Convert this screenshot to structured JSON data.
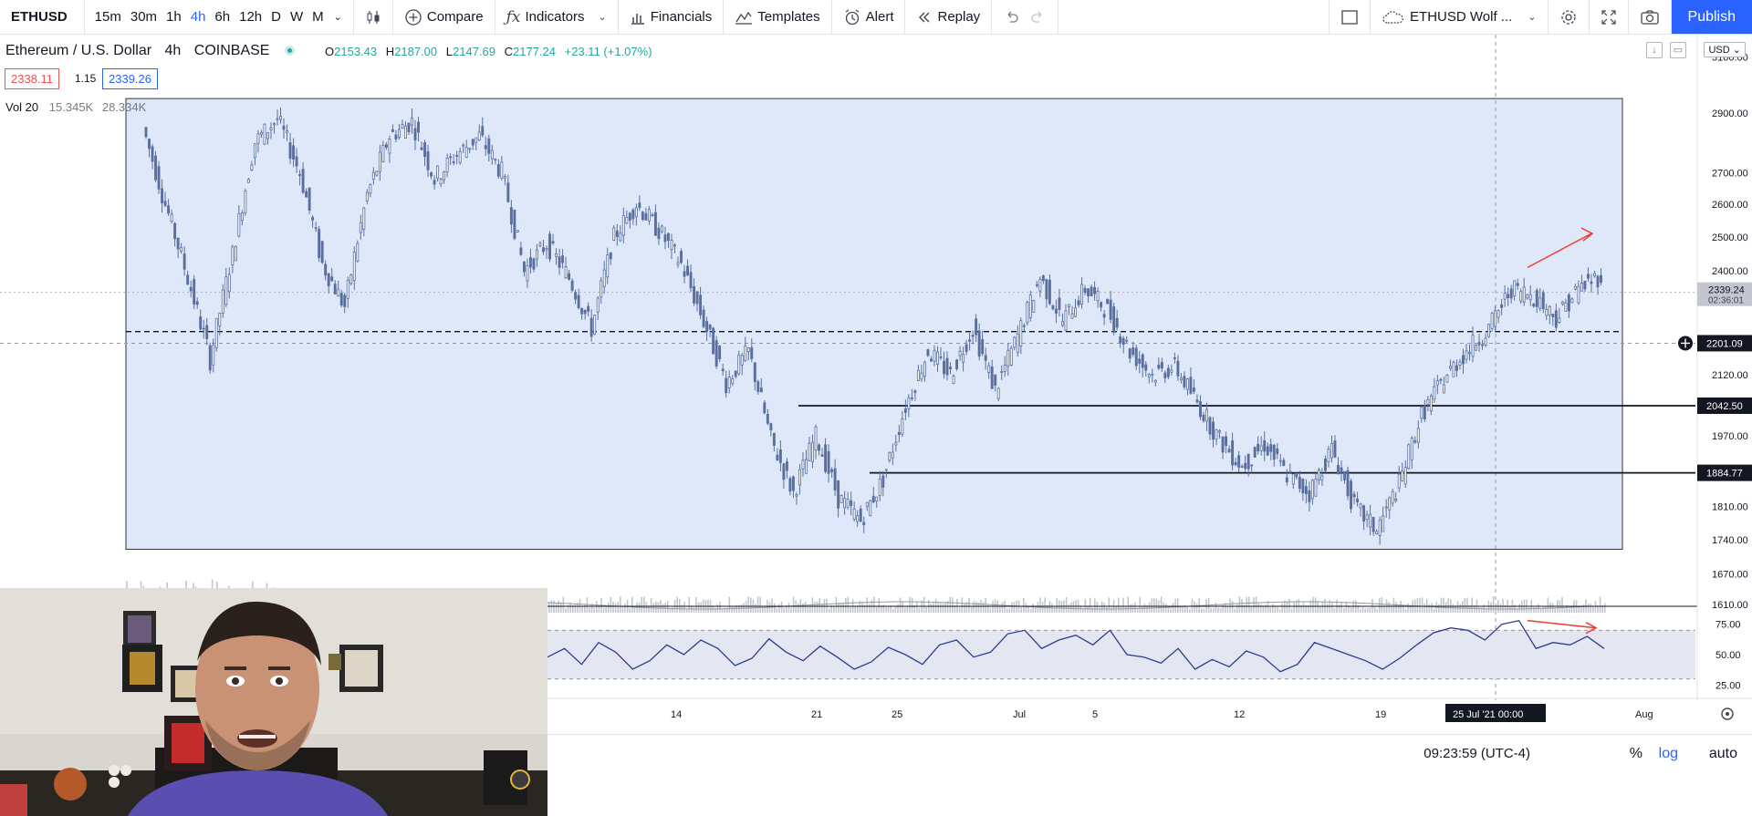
{
  "toolbar": {
    "symbol": "ETHUSD",
    "intervals": [
      "15m",
      "30m",
      "1h",
      "4h",
      "6h",
      "12h",
      "D",
      "W",
      "M"
    ],
    "active_interval": "4h",
    "compare": "Compare",
    "indicators": "Indicators",
    "financials": "Financials",
    "templates": "Templates",
    "alert": "Alert",
    "replay": "Replay",
    "layout_name": "ETHUSD Wolf ...",
    "publish": "Publish"
  },
  "legend": {
    "title": "Ethereum / U.S. Dollar",
    "interval": "4h",
    "exchange": "COINBASE",
    "open_label": "O",
    "open": "2153.43",
    "high_label": "H",
    "high": "2187.00",
    "low_label": "L",
    "low": "2147.69",
    "close_label": "C",
    "close": "2177.24",
    "change": "+23.11 (+1.07%)",
    "bid": "2338.11",
    "spread": "1.15",
    "ask": "2339.26",
    "volume_label": "Vol 20",
    "volume_value": "15.345K",
    "volume_ma": "28.334K",
    "currency": "USD"
  },
  "price_axis": {
    "ticks": [
      "3100.00",
      "2900.00",
      "2700.00",
      "2600.00",
      "2500.00",
      "2400.00",
      "2120.00",
      "1970.00",
      "1810.00",
      "1740.00",
      "1670.00",
      "1610.00"
    ],
    "current_price": "2339.24",
    "countdown": "02:36:01",
    "crosshair_price": "2201.09",
    "level_1": "2042.50",
    "level_2": "1884.77",
    "range_top": 2950,
    "range_bottom": 1720,
    "dashed_level": 2232
  },
  "rsi_axis": {
    "ticks": [
      "75.00",
      "50.00",
      "25.00"
    ],
    "upper_band": 70,
    "lower_band": 30
  },
  "time_axis": {
    "labels": [
      "14",
      "21",
      "25",
      "Jul",
      "5",
      "12",
      "19",
      "Aug"
    ],
    "crosshair_label": "25 Jul '21  00:00"
  },
  "status": {
    "clock": "09:23:59 (UTC-4)",
    "percent": "%",
    "log": "log",
    "auto": "auto"
  },
  "colors": {
    "range_fill": "#dfe8f9",
    "candle": "#5a6f9e",
    "rsi_line": "#2b3d8f",
    "annotation": "#ef3b36",
    "accent": "#2962ff"
  },
  "icons": [
    "candles-icon",
    "plus-circle-icon",
    "fx-icon",
    "bars-icon",
    "templates-icon",
    "alarm-clock-icon",
    "rewind-icon",
    "undo-icon",
    "redo-icon",
    "rectangle-icon",
    "cloud-icon",
    "gear-icon",
    "fullscreen-icon",
    "camera-icon",
    "crosshair-plus-icon",
    "settings-icon"
  ],
  "chart_data": {
    "type": "line",
    "title": "",
    "xlabel": "",
    "ylabel": "",
    "price_series_close": [
      2850,
      2600,
      2380,
      2160,
      2450,
      2800,
      2880,
      2700,
      2420,
      2300,
      2630,
      2820,
      2870,
      2680,
      2760,
      2820,
      2700,
      2400,
      2480,
      2380,
      2240,
      2500,
      2600,
      2520,
      2420,
      2260,
      2100,
      2180,
      1960,
      1840,
      1970,
      1830,
      1780,
      1870,
      2040,
      2180,
      2120,
      2240,
      2080,
      2220,
      2380,
      2260,
      2350,
      2290,
      2180,
      2120,
      2140,
      2050,
      1960,
      1900,
      1950,
      1880,
      1840,
      1940,
      1810,
      1760,
      1860,
      2020,
      2110,
      2180,
      2240,
      2350,
      2330,
      2270,
      2350,
      2390
    ],
    "rsi_series": [
      48,
      55,
      42,
      60,
      52,
      38,
      45,
      58,
      50,
      62,
      55,
      41,
      47,
      63,
      52,
      45,
      57,
      48,
      38,
      44,
      56,
      50,
      42,
      58,
      62,
      48,
      52,
      67,
      70,
      55,
      62,
      66,
      58,
      70,
      50,
      48,
      43,
      55,
      38,
      46,
      40,
      53,
      48,
      36,
      42,
      60,
      55,
      50,
      45,
      38,
      47,
      58,
      68,
      72,
      70,
      62,
      75,
      78,
      55,
      60,
      58,
      65,
      55
    ],
    "ylim": [
      1610,
      3150
    ],
    "rsi_ylim": [
      20,
      80
    ]
  }
}
